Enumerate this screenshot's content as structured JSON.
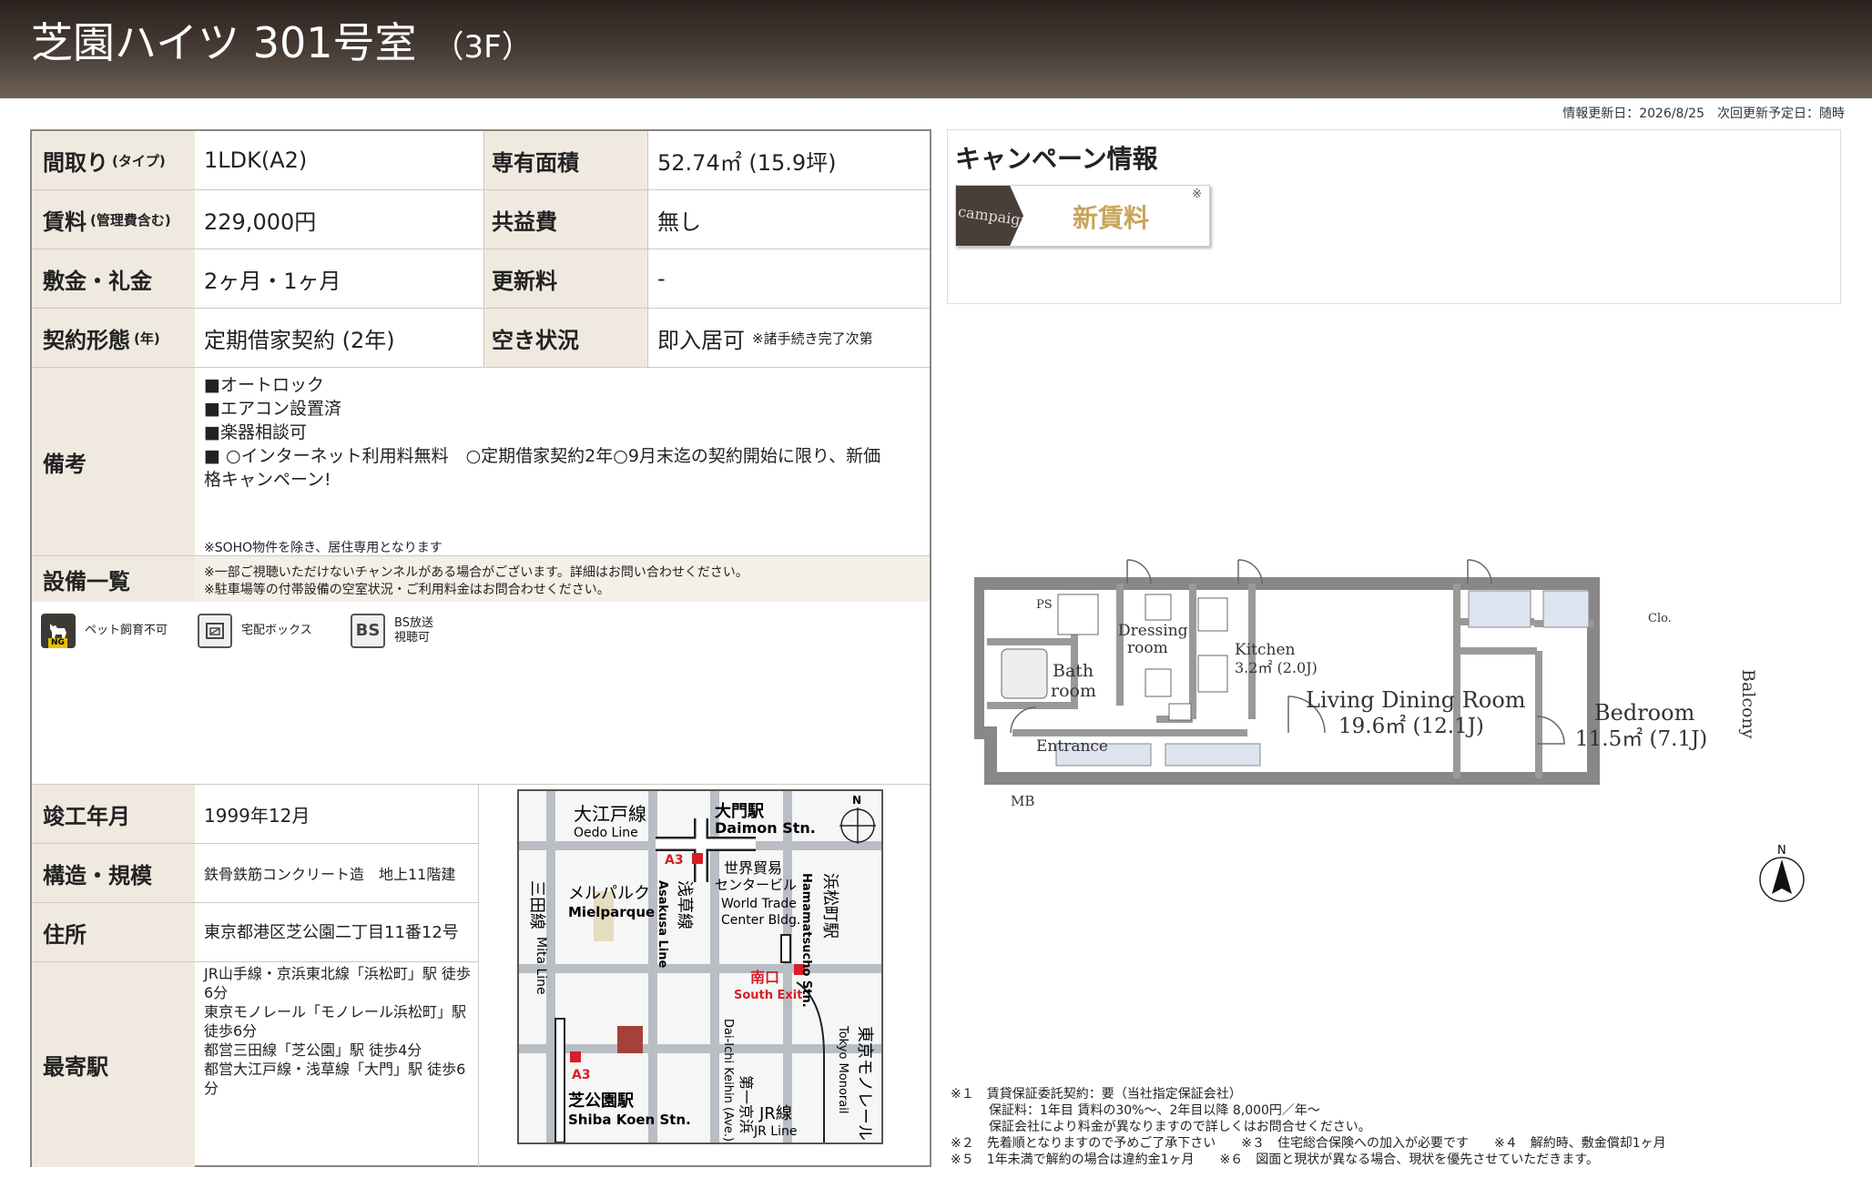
{
  "header": {
    "title": "芝園ハイツ 301号室",
    "floor": "（3F）"
  },
  "update_info": "情報更新日：2026/8/25　次回更新予定日：随時",
  "spec": {
    "layout_label": "間取り",
    "layout_sub": "(タイプ)",
    "layout_value": "1LDK(A2)",
    "area_label": "専有面積",
    "area_value": "52.74㎡ (15.9坪)",
    "rent_label": "賃料",
    "rent_sub": "(管理費含む)",
    "rent_value": "229,000円",
    "common_label": "共益費",
    "common_value": "無し",
    "deposit_label": "敷金・礼金",
    "deposit_value": "2ヶ月・1ヶ月",
    "renewal_label": "更新料",
    "renewal_value": "-",
    "contract_label": "契約形態",
    "contract_sub": "(年)",
    "contract_value": "定期借家契約 (2年)",
    "vacancy_label": "空き状況",
    "vacancy_value": "即入居可",
    "vacancy_note": "※諸手続き完了次第",
    "remarks_label": "備考",
    "remarks": [
      "■オートロック",
      "■エアコン設置済",
      "■楽器相談可",
      "■ ○インターネット利用料無料　○定期借家契約2年○9月末迄の契約開始に限り、新価",
      "格キャンペーン!"
    ],
    "soho_note": "※SOHO物件を除き、居住専用となります",
    "equipment_label": "設備一覧",
    "equipment_notes": [
      "※一部ご視聴いただけないチャンネルがある場合がございます。詳細はお問い合わせください。",
      "※駐車場等の付帯設備の空室状況・ご利用料金はお問合わせください。"
    ],
    "icons": [
      {
        "name": "pet-icon",
        "label": "ペット飼育不可",
        "badge": "NG"
      },
      {
        "name": "delivery-box-icon",
        "label": "宅配ボックス"
      },
      {
        "name": "bs-icon",
        "label_line1": "BS放送",
        "label_line2": "視聴可",
        "glyph": "BS"
      }
    ],
    "built_label": "竣工年月",
    "built_value": "1999年12月",
    "structure_label": "構造・規模",
    "structure_value": "鉄骨鉄筋コンクリート造　地上11階建",
    "address_label": "住所",
    "address_value": "東京都港区芝公園二丁目11番12号",
    "station_label": "最寄駅",
    "station_lines": [
      "JR山手線・京浜東北線「浜松町」駅 徒歩6分",
      "東京モノレール「モノレール浜松町」駅 徒歩6分",
      "都営三田線「芝公園」駅 徒歩4分",
      "都営大江戸線・浅草線「大門」駅 徒歩6分"
    ]
  },
  "map": {
    "oedo": "大江戸線",
    "oedo_en": "Oedo Line",
    "daimon": "大門駅",
    "daimon_en": "Daimon Stn.",
    "a3": "A3",
    "mita": "三田線",
    "mita_en": "Mita Line",
    "mielparque": "メルパルク",
    "mielparque_en": "Mielparque",
    "asakusa": "浅草線",
    "asakusa_en": "Asakusa Line",
    "wtc": "世界貿易",
    "wtc2": "センタービル",
    "wtc_en": "World Trade",
    "wtc_en2": "Center Bldg.",
    "hamamatsucho": "浜松町駅",
    "hamamatsucho_en": "Hamamatsucho Stn.",
    "south": "南口",
    "south_en": "South Exit",
    "daiichi": "第一京浜",
    "daiichi_en": "Dai-Ichi Keihin (Ave.)",
    "jr": "JR線",
    "jr_en": "JR Line",
    "monorail": "東京モノレール",
    "monorail_en": "Tokyo Monorail",
    "shibakoen": "芝公園駅",
    "shibakoen_en": "Shiba Koen Stn.",
    "north": "N"
  },
  "campaign": {
    "title": "キャンペーン情報",
    "tag": "campaign",
    "text": "新賃料",
    "mark": "※"
  },
  "floorplan": {
    "ps": "PS",
    "dressing": "Dressing",
    "dressing2": "room",
    "bath": "Bath",
    "bath2": "room",
    "kitchen": "Kitchen",
    "kitchen_size": "3.2㎡ (2.0J)",
    "ldr": "Living Dining Room",
    "ldr_size": "19.6㎡ (12.1J)",
    "bedroom": "Bedroom",
    "bedroom_size": "11.5㎡ (7.1J)",
    "clo": "Clo.",
    "balcony": "Balcony",
    "entrance": "Entrance",
    "mb": "MB",
    "north": "N"
  },
  "notes": [
    "※１　賃貸保証委託契約：要（当社指定保証会社）",
    "　　　保証料：1年目 賃料の30%～、2年目以降 8,000円／年～",
    "　　　保証会社により料金が異なりますので詳しくはお問合せください。",
    "※２　先着順となりますので予めご了承下さい　　※３　住宅総合保険への加入が必要です　　※４　解約時、敷金償却1ヶ月",
    "※５　1年未満で解約の場合は違約金1ヶ月　　※６　図面と現状が異なる場合、現状を優先させていただきます。"
  ]
}
